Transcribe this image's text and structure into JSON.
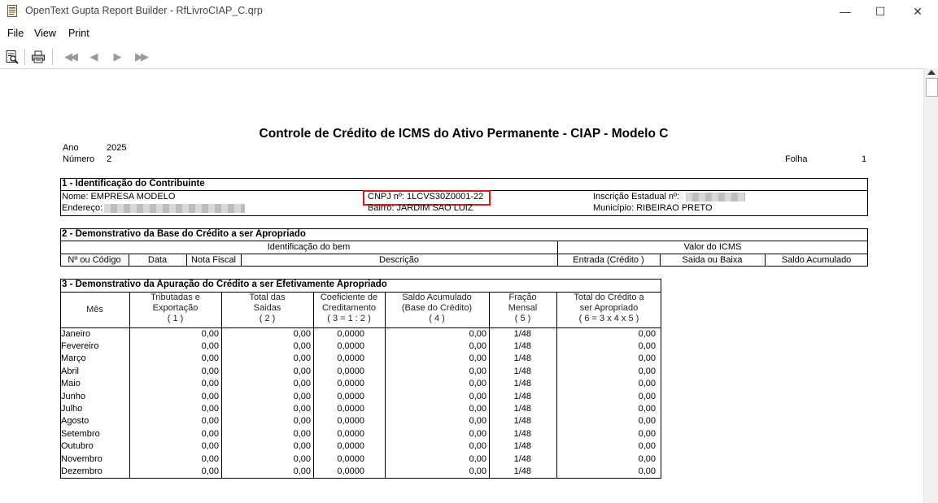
{
  "window": {
    "title": "OpenText Gupta Report Builder - RfLivroCIAP_C.qrp",
    "minimize_glyph": "—",
    "maximize_glyph": "☐",
    "close_glyph": "✕"
  },
  "menu": {
    "file": "File",
    "view": "View",
    "print": "Print"
  },
  "toolbar": {
    "preview_icon": "print-preview-icon",
    "print_icon": "printer-icon",
    "first_glyph": "◀◀",
    "prev_glyph": "◀",
    "next_glyph": "▶",
    "last_glyph": "▶▶"
  },
  "report": {
    "title": "Controle de Crédito de ICMS do Ativo Permanente - CIAP - Modelo C",
    "ano_label": "Ano",
    "ano_value": "2025",
    "numero_label": "Número",
    "numero_value": "2",
    "folha_label": "Folha",
    "folha_value": "1",
    "section1": {
      "title": "1 - Identificação do Contribuinte",
      "nome": "Nome:  EMPRESA MODELO",
      "cnpj": "CNPJ nº: 1LCVS30Z0001-22",
      "inscricao": "Inscrição Estadual nº:",
      "endereco": "Endereço:",
      "bairro": "Bairro:  JARDIM SAO LUIZ",
      "municipio": "Município:  RIBEIRAO PRETO"
    },
    "section2": {
      "title": "2 - Demonstrativo da Base do Crédito a ser Apropriado",
      "group_bem": "Identificação do bem",
      "group_icms": "Valor do ICMS",
      "col_codigo": "Nº ou Código",
      "col_data": "Data",
      "col_nf": "Nota Fiscal",
      "col_desc": "Descrição",
      "col_entrada": "Entrada (Crédito )",
      "col_saida": "Saida ou Baixa",
      "col_saldo": "Saldo Acumulado"
    },
    "section3": {
      "title": "3 - Demonstrativo da Apuração do Crédito a ser Efetivamente Apropriado",
      "h_mes": "Mês",
      "h1_a": "Tributadas e",
      "h1_b": "Exportação",
      "h1_c": "( 1 )",
      "h2_a": "Total das",
      "h2_b": "Saidas",
      "h2_c": "( 2 )",
      "h3_a": "Coeficiente de",
      "h3_b": "Creditamento",
      "h3_c": "( 3 = 1 : 2 )",
      "h4_a": "Saldo Acumulado",
      "h4_b": "(Base do Crédito)",
      "h4_c": "( 4 )",
      "h5_a": "Fração",
      "h5_b": "Mensal",
      "h5_c": "( 5 )",
      "h6_a": "Total do Crédito a",
      "h6_b": "ser Apropriado",
      "h6_c": "( 6 = 3 x 4 x 5 )",
      "rows": [
        {
          "mes": "Janeiro",
          "c1": "0,00",
          "c2": "0,00",
          "c3": "0,0000",
          "c4": "0,00",
          "c5": "1/48",
          "c6": "0,00"
        },
        {
          "mes": "Fevereiro",
          "c1": "0,00",
          "c2": "0,00",
          "c3": "0,0000",
          "c4": "0,00",
          "c5": "1/48",
          "c6": "0,00"
        },
        {
          "mes": "Março",
          "c1": "0,00",
          "c2": "0,00",
          "c3": "0,0000",
          "c4": "0,00",
          "c5": "1/48",
          "c6": "0,00"
        },
        {
          "mes": "Abril",
          "c1": "0,00",
          "c2": "0,00",
          "c3": "0,0000",
          "c4": "0,00",
          "c5": "1/48",
          "c6": "0,00"
        },
        {
          "mes": "Maio",
          "c1": "0,00",
          "c2": "0,00",
          "c3": "0,0000",
          "c4": "0,00",
          "c5": "1/48",
          "c6": "0,00"
        },
        {
          "mes": "Junho",
          "c1": "0,00",
          "c2": "0,00",
          "c3": "0,0000",
          "c4": "0,00",
          "c5": "1/48",
          "c6": "0,00"
        },
        {
          "mes": "Julho",
          "c1": "0,00",
          "c2": "0,00",
          "c3": "0,0000",
          "c4": "0,00",
          "c5": "1/48",
          "c6": "0,00"
        },
        {
          "mes": "Agosto",
          "c1": "0,00",
          "c2": "0,00",
          "c3": "0,0000",
          "c4": "0,00",
          "c5": "1/48",
          "c6": "0,00"
        },
        {
          "mes": "Setembro",
          "c1": "0,00",
          "c2": "0,00",
          "c3": "0,0000",
          "c4": "0,00",
          "c5": "1/48",
          "c6": "0,00"
        },
        {
          "mes": "Outubro",
          "c1": "0,00",
          "c2": "0,00",
          "c3": "0,0000",
          "c4": "0,00",
          "c5": "1/48",
          "c6": "0,00"
        },
        {
          "mes": "Novembro",
          "c1": "0,00",
          "c2": "0,00",
          "c3": "0,0000",
          "c4": "0,00",
          "c5": "1/48",
          "c6": "0,00"
        },
        {
          "mes": "Dezembro",
          "c1": "0,00",
          "c2": "0,00",
          "c3": "0,0000",
          "c4": "0,00",
          "c5": "1/48",
          "c6": "0,00"
        }
      ]
    }
  }
}
